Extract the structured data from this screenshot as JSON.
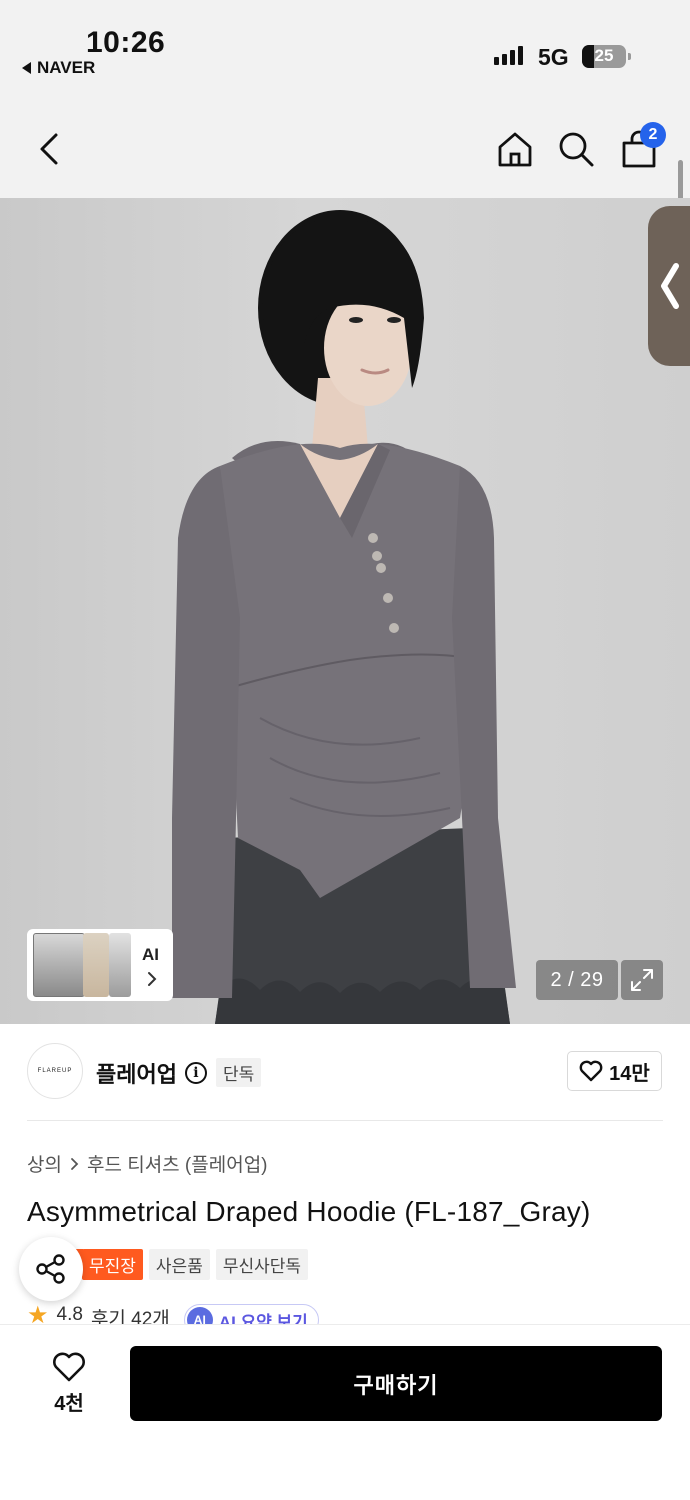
{
  "status_bar": {
    "time": "10:26",
    "back_app": "NAVER",
    "network": "5G",
    "battery": "25"
  },
  "nav": {
    "cart_count": "2",
    "icons": [
      "back-icon",
      "home-icon",
      "search-icon",
      "cart-icon"
    ]
  },
  "gallery": {
    "counter": "2 / 29",
    "ai_label": "AI"
  },
  "brand": {
    "logo_text": "FLAREUP",
    "name": "플레어업",
    "exclusive_tag": "단독",
    "like_count": "14만"
  },
  "product": {
    "breadcrumb": [
      "상의",
      "후드 티셔츠 (플레어업)"
    ],
    "title": "Asymmetrical Draped Hoodie (FL-187_Gray)",
    "tags": [
      "무진장",
      "사은품",
      "무신사단독"
    ],
    "rating": "4.8",
    "reviews": "후기 42개",
    "ai_summary": "AI 요약 보기",
    "ai_badge": "AI"
  },
  "bottom_bar": {
    "wish_count": "4천",
    "buy_label": "구매하기"
  },
  "colors": {
    "accent_orange": "#ff5a1f",
    "badge_blue": "#2563eb",
    "ai_purple": "#5b57e0"
  }
}
